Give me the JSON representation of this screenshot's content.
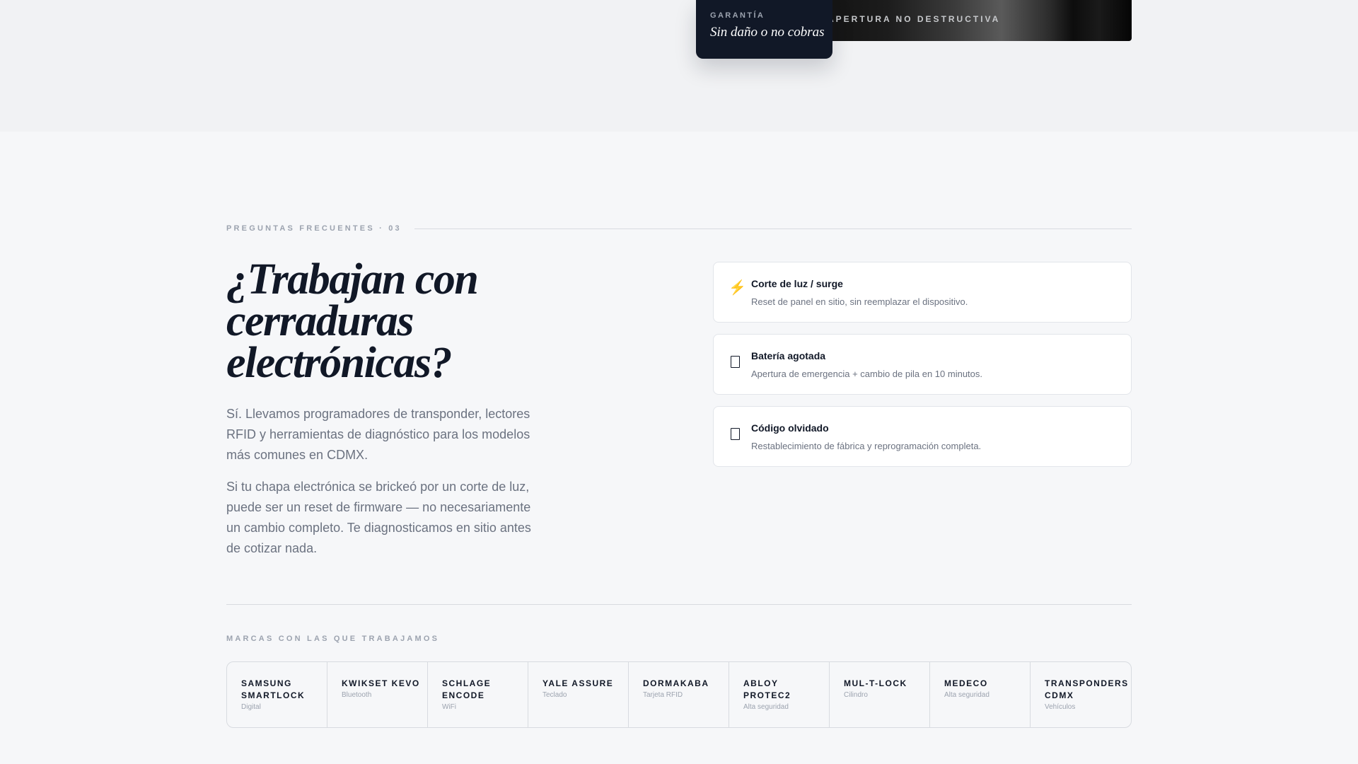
{
  "hero": {
    "caption": "APERTURA NO DESTRUCTIVA",
    "guarantee_label": "GARANTÍA",
    "guarantee_text": "Sin daño o no cobras"
  },
  "faq": {
    "eyebrow": "PREGUNTAS FRECUENTES · 03",
    "headline": "¿Trabajan con cerraduras electrónicas?",
    "paragraphs": [
      "Sí. Llevamos programadores de transponder, lectores RFID y herramientas de diagnóstico para los modelos más comunes en CDMX.",
      "Si tu chapa electrónica se brickeó por un corte de luz, puede ser un reset de firmware — no necesariamente un cambio completo. Te diagnosticamos en sitio antes de cotizar nada."
    ],
    "cards": [
      {
        "icon": "lightning-icon",
        "glyph": "⚡",
        "title": "Corte de luz / surge",
        "desc": "Reset de panel en sitio, sin reemplazar el dispositivo."
      },
      {
        "icon": "battery-icon",
        "title": "Batería agotada",
        "desc": "Apertura de emergencia + cambio de pila en 10 minutos."
      },
      {
        "icon": "keypad-icon",
        "title": "Código olvidado",
        "desc": "Restablecimiento de fábrica y reprogramación completa."
      }
    ]
  },
  "brands": {
    "label": "MARCAS CON LAS QUE TRABAJAMOS",
    "items": [
      {
        "name": "SAMSUNG SMARTLOCK",
        "sub": "Digital"
      },
      {
        "name": "KWIKSET KEVO",
        "sub": "Bluetooth"
      },
      {
        "name": "SCHLAGE ENCODE",
        "sub": "WiFi"
      },
      {
        "name": "YALE ASSURE",
        "sub": "Teclado"
      },
      {
        "name": "DORMAKABA",
        "sub": "Tarjeta RFID"
      },
      {
        "name": "ABLOY PROTEC2",
        "sub": "Alta seguridad"
      },
      {
        "name": "MUL-T-LOCK",
        "sub": "Cilindro"
      },
      {
        "name": "MEDECO",
        "sub": "Alta seguridad"
      },
      {
        "name": "TRANSPONDERS CDMX",
        "sub": "Vehículos"
      }
    ]
  }
}
